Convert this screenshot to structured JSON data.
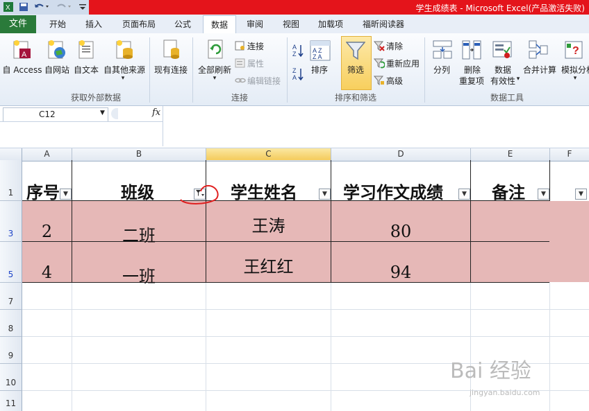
{
  "window": {
    "title": "学生成绩表 - Microsoft Excel(产品激活失败)"
  },
  "quick_access": {
    "save_icon": "save-icon",
    "undo_icon": "undo-icon",
    "redo_icon": "redo-icon"
  },
  "menu": {
    "file": "文件",
    "tabs": [
      "开始",
      "插入",
      "页面布局",
      "公式",
      "数据",
      "审阅",
      "视图",
      "加载项",
      "福昕阅读器"
    ],
    "active": "数据"
  },
  "ribbon": {
    "get_external": {
      "label": "获取外部数据",
      "buttons": [
        "自 Access",
        "自网站",
        "自文本",
        "自其他来源",
        "现有连接"
      ]
    },
    "connections": {
      "label": "连接",
      "refresh_all": "全部刷新",
      "connections": "连接",
      "properties": "属性",
      "edit_links": "编辑链接"
    },
    "sort_filter": {
      "label": "排序和筛选",
      "sort": "排序",
      "filter": "筛选",
      "clear": "清除",
      "reapply": "重新应用",
      "advanced": "高级"
    },
    "data_tools": {
      "label": "数据工具",
      "split": "分列",
      "remove_dup_1": "删除",
      "remove_dup_2": "重复项",
      "validation_1": "数据",
      "validation_2": "有效性",
      "consolidate": "合并计算",
      "whatif": "模拟分析"
    }
  },
  "formula_bar": {
    "name_box": "C12",
    "fx": "fx",
    "formula": ""
  },
  "columns": [
    "A",
    "B",
    "C",
    "D",
    "E",
    "F"
  ],
  "header_row": {
    "row": "1",
    "cells": [
      "序号",
      "班级",
      "学生姓名",
      "学习作文成绩",
      "备注",
      ""
    ]
  },
  "data_rows": [
    {
      "row": "3",
      "cells": [
        "2",
        "二班",
        "王涛",
        "80",
        ""
      ]
    },
    {
      "row": "5",
      "cells": [
        "4",
        "一班",
        "王红红",
        "94",
        ""
      ]
    }
  ],
  "empty_rows": [
    "7",
    "8",
    "9",
    "10",
    "11"
  ],
  "watermark": {
    "main": "Bai 经验",
    "sub": "jingyan.baidu.com"
  },
  "colors": {
    "filtered_row_bg": "#e6b8b7",
    "file_tab": "#2a7a3a",
    "title_bar": "#e4141b",
    "filter_active": "#f7cf5e",
    "annotation": "#e02020"
  }
}
